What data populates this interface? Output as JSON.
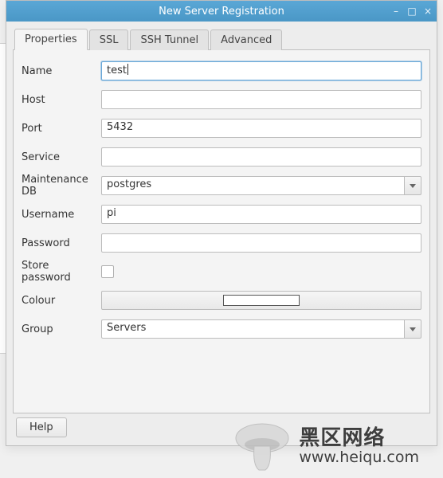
{
  "window": {
    "title": "New Server Registration"
  },
  "tabs": {
    "properties": "Properties",
    "ssl": "SSL",
    "ssh": "SSH Tunnel",
    "advanced": "Advanced"
  },
  "form": {
    "name": {
      "label": "Name",
      "value": "test"
    },
    "host": {
      "label": "Host",
      "value": ""
    },
    "port": {
      "label": "Port",
      "value": "5432"
    },
    "service": {
      "label": "Service",
      "value": ""
    },
    "maintenance_db": {
      "label": "Maintenance DB",
      "value": "postgres"
    },
    "username": {
      "label": "Username",
      "value": "pi"
    },
    "password": {
      "label": "Password",
      "value": ""
    },
    "store_password": {
      "label": "Store password",
      "checked": false
    },
    "colour": {
      "label": "Colour",
      "swatch": "#ffffff"
    },
    "group": {
      "label": "Group",
      "value": "Servers"
    }
  },
  "buttons": {
    "help": "Help"
  },
  "watermark": {
    "brand_cn": "黑区网络",
    "url": "www.heiqu.com"
  }
}
